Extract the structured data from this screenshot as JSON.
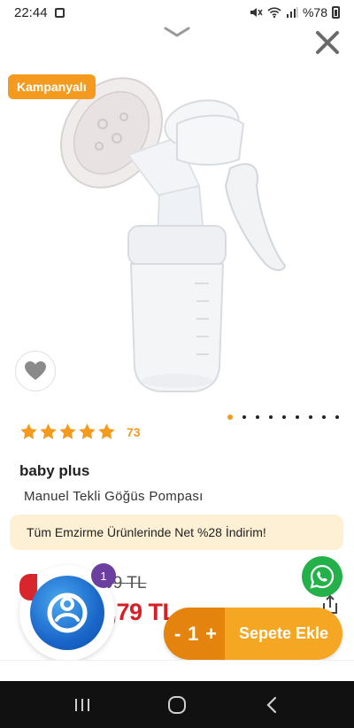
{
  "status_bar": {
    "time": "22:44",
    "battery": "%78"
  },
  "product": {
    "campaign_badge": "Kampanyalı",
    "rating_count": "73",
    "stars": 5,
    "brand": "baby plus",
    "name": "Manuel Tekli Göğüs Pompası"
  },
  "gallery": {
    "total_images": 9,
    "active_index": 0
  },
  "campaign_banner": "Tüm Emzirme Ürünlerinde Net %28 İndirim!",
  "price": {
    "old": "‚99 TL",
    "new": "4,79 TL"
  },
  "notification": {
    "count": "1"
  },
  "cart": {
    "decrement": "-",
    "quantity": "1",
    "increment": "+",
    "add_label": "Sepete Ekle"
  },
  "colors": {
    "accent": "#f39a1f",
    "price_red": "#d61f26",
    "banner_bg": "#fdf0d4",
    "whatsapp_green": "#25b14a"
  },
  "icons": [
    "chevron-down-icon",
    "close-icon",
    "heart-icon",
    "star-icon",
    "whatsapp-icon",
    "share-icon",
    "recent-apps-icon",
    "home-icon",
    "back-icon"
  ]
}
